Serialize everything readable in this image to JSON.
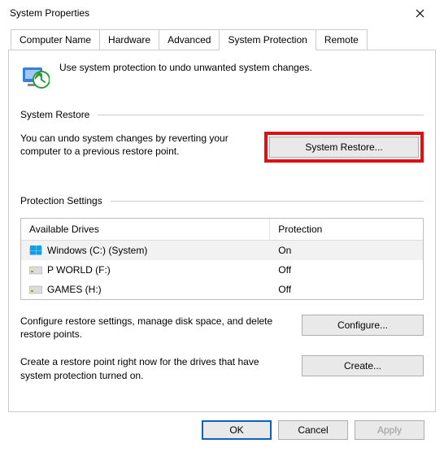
{
  "window": {
    "title": "System Properties"
  },
  "tabs": {
    "items": [
      "Computer Name",
      "Hardware",
      "Advanced",
      "System Protection",
      "Remote"
    ],
    "active": 3
  },
  "intro": "Use system protection to undo unwanted system changes.",
  "restore": {
    "heading": "System Restore",
    "desc": "You can undo system changes by reverting your computer to a previous restore point.",
    "button": "System Restore..."
  },
  "protection": {
    "heading": "Protection Settings",
    "columns": {
      "drive": "Available Drives",
      "prot": "Protection"
    },
    "rows": [
      {
        "name": "Windows (C:) (System)",
        "prot": "On",
        "type": "os"
      },
      {
        "name": "P WORLD (F:)",
        "prot": "Off",
        "type": "hdd"
      },
      {
        "name": "GAMES (H:)",
        "prot": "Off",
        "type": "hdd"
      }
    ],
    "configure": {
      "desc": "Configure restore settings, manage disk space, and delete restore points.",
      "button": "Configure..."
    },
    "create": {
      "desc": "Create a restore point right now for the drives that have system protection turned on.",
      "button": "Create..."
    }
  },
  "buttons": {
    "ok": "OK",
    "cancel": "Cancel",
    "apply": "Apply"
  }
}
